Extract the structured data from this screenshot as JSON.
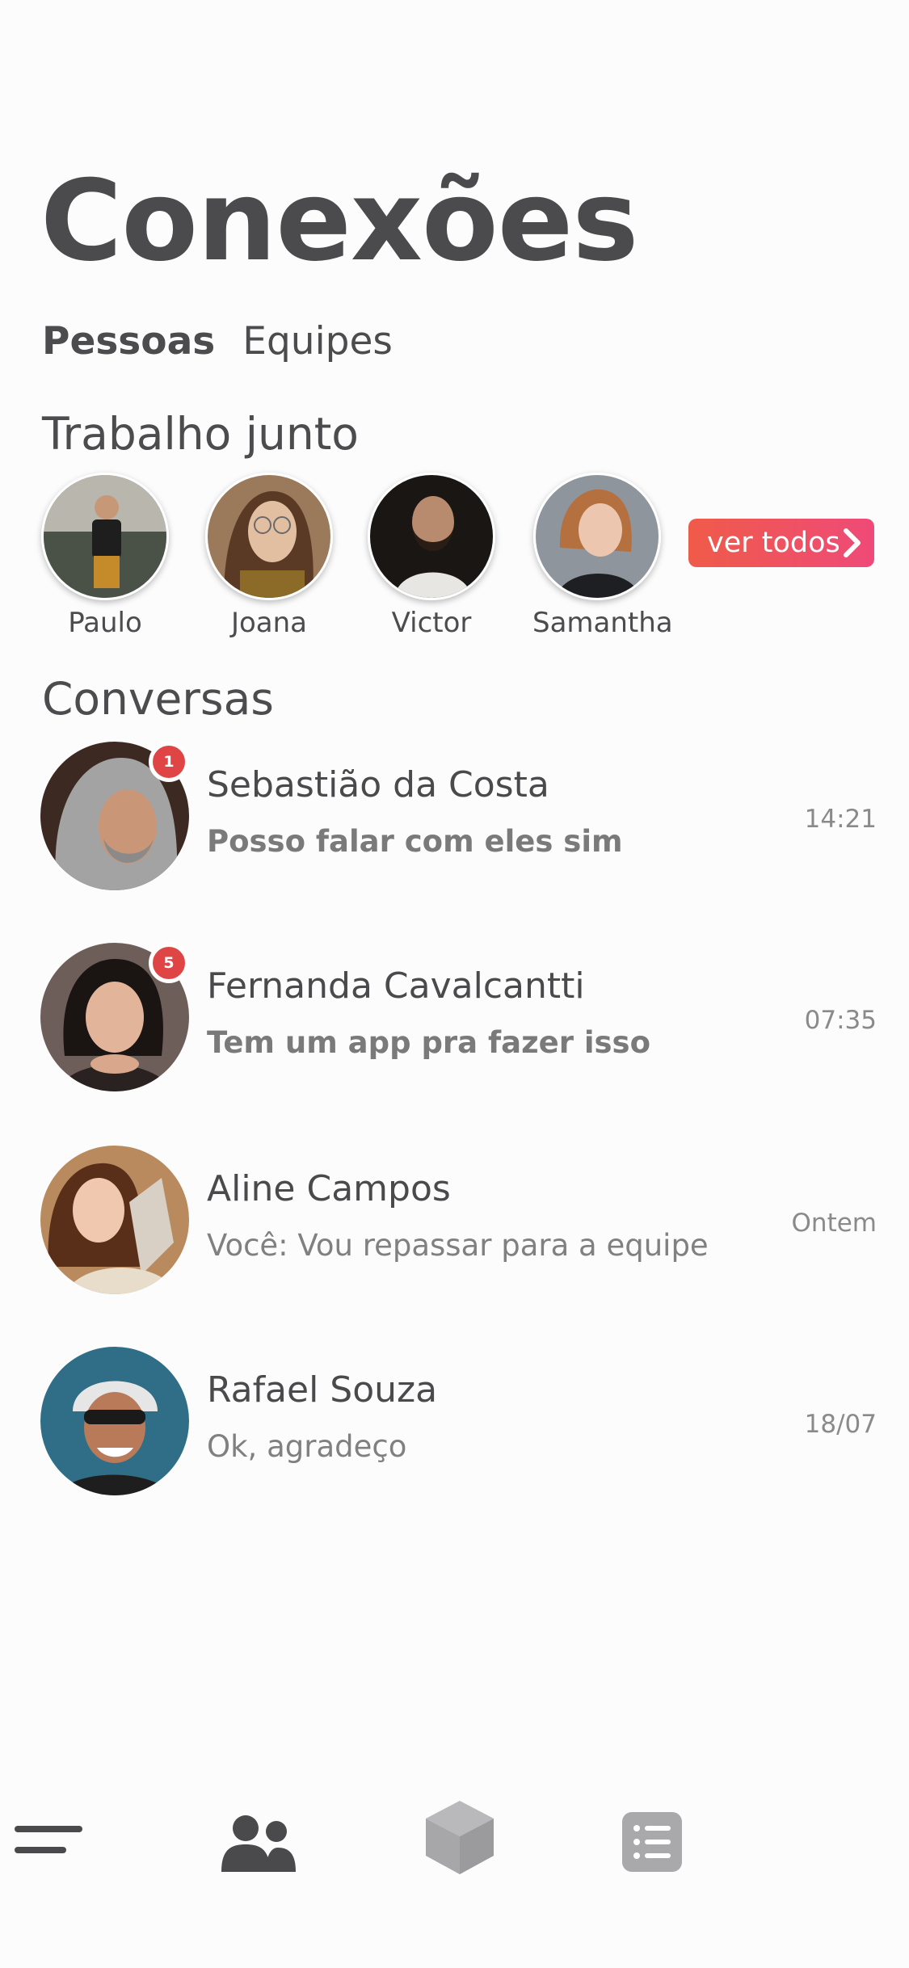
{
  "header": {
    "title": "Conexões"
  },
  "tabs": [
    {
      "label": "Pessoas",
      "active": true
    },
    {
      "label": "Equipes",
      "active": false
    }
  ],
  "worked_together": {
    "title": "Trabalho junto",
    "people": [
      {
        "name": "Paulo"
      },
      {
        "name": "Joana"
      },
      {
        "name": "Victor"
      },
      {
        "name": "Samantha"
      }
    ],
    "see_all_label": "ver todos"
  },
  "conversations": {
    "title": "Conversas",
    "items": [
      {
        "name": "Sebastião da Costa",
        "message": "Posso falar com eles sim",
        "time": "14:21",
        "unread": "1"
      },
      {
        "name": "Fernanda Cavalcantti",
        "message": "Tem um app pra fazer isso",
        "time": "07:35",
        "unread": "5"
      },
      {
        "name": "Aline Campos",
        "message": "Você: Vou repassar para a equipe",
        "time": "Ontem"
      },
      {
        "name": "Rafael Souza",
        "message": "Ok, agradeço",
        "time": "18/07"
      }
    ]
  },
  "bottom_nav": [
    {
      "icon": "menu-icon"
    },
    {
      "icon": "people-icon"
    },
    {
      "icon": "cube-icon"
    },
    {
      "icon": "list-icon"
    }
  ],
  "colors": {
    "accent_start": "#ef5b49",
    "accent_end": "#ef4a78",
    "badge": "#e04545",
    "text": "#4a4a4c",
    "icon_gray": "#a9a9ab"
  }
}
